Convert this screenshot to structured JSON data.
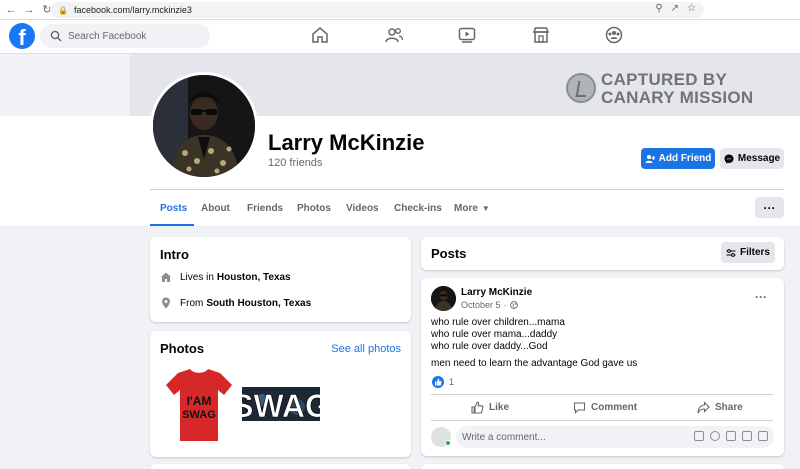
{
  "browser": {
    "url": "facebook.com/larry.mckinzie3"
  },
  "topbar": {
    "search_placeholder": "Search Facebook",
    "nav_icons": [
      "home-icon",
      "friends-icon",
      "watch-icon",
      "marketplace-icon",
      "groups-icon"
    ]
  },
  "watermark": {
    "line1": "CAPTURED BY",
    "line2": "CANARY MISSION"
  },
  "profile": {
    "name": "Larry McKinzie",
    "friends": "120 friends",
    "add_friend_label": "Add Friend",
    "message_label": "Message"
  },
  "tabs": [
    {
      "label": "Posts",
      "active": true
    },
    {
      "label": "About"
    },
    {
      "label": "Friends"
    },
    {
      "label": "Photos"
    },
    {
      "label": "Videos"
    },
    {
      "label": "Check-ins"
    },
    {
      "label": "More"
    }
  ],
  "more_dots": "···",
  "intro": {
    "title": "Intro",
    "lives_prefix": "Lives in",
    "lives_place": "Houston, Texas",
    "from_prefix": "From",
    "from_place": "South Houston, Texas"
  },
  "photos": {
    "title": "Photos",
    "see_all": "See all photos",
    "shirt_text_1": "I'AM",
    "shirt_text_2": "SWAG",
    "swag_text": "SWAG"
  },
  "posts": {
    "title": "Posts",
    "filters_label": "Filters",
    "post": {
      "author": "Larry McKinzie",
      "date": "October 5",
      "menu": "···",
      "lines": [
        "who rule over children...mama",
        "who rule over mama...daddy",
        "who rule over daddy...God",
        "men need to learn the advantage God gave us"
      ],
      "likes": "1",
      "like_label": "Like",
      "comment_label": "Comment",
      "share_label": "Share",
      "comment_placeholder": "Write a comment..."
    }
  },
  "colors": {
    "brand": "#1877f2",
    "accent": "#1b74e4",
    "page_bg": "#f0f2f5",
    "secondary_text": "#65676b"
  }
}
